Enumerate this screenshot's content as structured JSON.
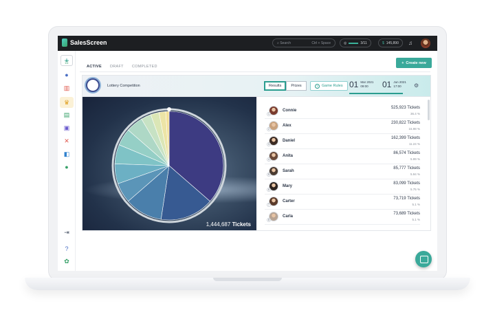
{
  "app": {
    "name": "SalesScreen"
  },
  "topbar": {
    "search_placeholder": "Search",
    "search_shortcut": "Ctrl + Space",
    "progress_value": "3/11",
    "coins": "145,890"
  },
  "tabs": [
    "ACTIVE",
    "DRAFT",
    "COMPLETED"
  ],
  "create_button": "Create new",
  "competition": {
    "name": "Lottery Competition",
    "view_results": "Results",
    "view_prizes": "Prizes",
    "rules_button": "Game Rules",
    "start": {
      "day": "01",
      "month_year": "Mar 2021",
      "time": "09:00"
    },
    "end": {
      "day": "01",
      "month_year": "Jun 2021",
      "time": "17:00"
    },
    "total_value": "1,444,687",
    "total_label": "Tickets"
  },
  "leaderboard": [
    {
      "rank": "1",
      "name": "Connie",
      "tickets": "525,923 Tickets",
      "pct": "36.4 %"
    },
    {
      "rank": "2",
      "name": "Alex",
      "tickets": "230,822 Tickets",
      "pct": "15.98 %"
    },
    {
      "rank": "3",
      "name": "Daniel",
      "tickets": "162,399 Tickets",
      "pct": "11.24 %"
    },
    {
      "rank": "4",
      "name": "Anita",
      "tickets": "86,574 Tickets",
      "pct": "5.99 %"
    },
    {
      "rank": "5",
      "name": "Sarah",
      "tickets": "85,777 Tickets",
      "pct": "5.94 %"
    },
    {
      "rank": "6",
      "name": "Mary",
      "tickets": "83,099 Tickets",
      "pct": "5.75 %"
    },
    {
      "rank": "7",
      "name": "Carter",
      "tickets": "73,719 Tickets",
      "pct": "5.1 %"
    },
    {
      "rank": "8",
      "name": "Carla",
      "tickets": "73,689 Tickets",
      "pct": "5.1 %"
    }
  ],
  "pie_slices": [
    36.4,
    15.98,
    11.24,
    5.99,
    5.94,
    5.75,
    5.1,
    5.1,
    3.0,
    2.5,
    2.0,
    1.0
  ],
  "pie_colors": [
    "#3d3b82",
    "#375a92",
    "#4a7fab",
    "#5b95b8",
    "#6cb0c4",
    "#7fc3c6",
    "#95cfc6",
    "#aed8c6",
    "#c7e2c4",
    "#dbe6b6",
    "#ece4a6",
    "#f3df96"
  ],
  "avatar_colors": [
    "#7a3b2e",
    "#c9a27e",
    "#3b2a22",
    "#6b4a3a",
    "#4a3a30",
    "#2e2420",
    "#5a3a2a",
    "#b8a493"
  ],
  "sidebar_icons": [
    {
      "name": "home-icon",
      "glyph": "⌂",
      "color": "#38a169"
    },
    {
      "name": "chat-icon",
      "glyph": "●",
      "color": "#4a6fc4"
    },
    {
      "name": "stats-icon",
      "glyph": "▥",
      "color": "#e05a4f"
    },
    {
      "name": "trophy-icon",
      "glyph": "♛",
      "color": "#e0a020"
    },
    {
      "name": "board-icon",
      "glyph": "▤",
      "color": "#38a169"
    },
    {
      "name": "gift-icon",
      "glyph": "▣",
      "color": "#6a5acd"
    },
    {
      "name": "swords-icon",
      "glyph": "✕",
      "color": "#e05a4f"
    },
    {
      "name": "cards-icon",
      "glyph": "◧",
      "color": "#3182ce"
    },
    {
      "name": "bulb-icon",
      "glyph": "●",
      "color": "#38a169"
    },
    {
      "name": "logout-icon",
      "glyph": "⇥",
      "color": "#4a5568"
    },
    {
      "name": "help-icon",
      "glyph": "?",
      "color": "#4a6fc4"
    },
    {
      "name": "settings-icon",
      "glyph": "✿",
      "color": "#38a169"
    }
  ]
}
